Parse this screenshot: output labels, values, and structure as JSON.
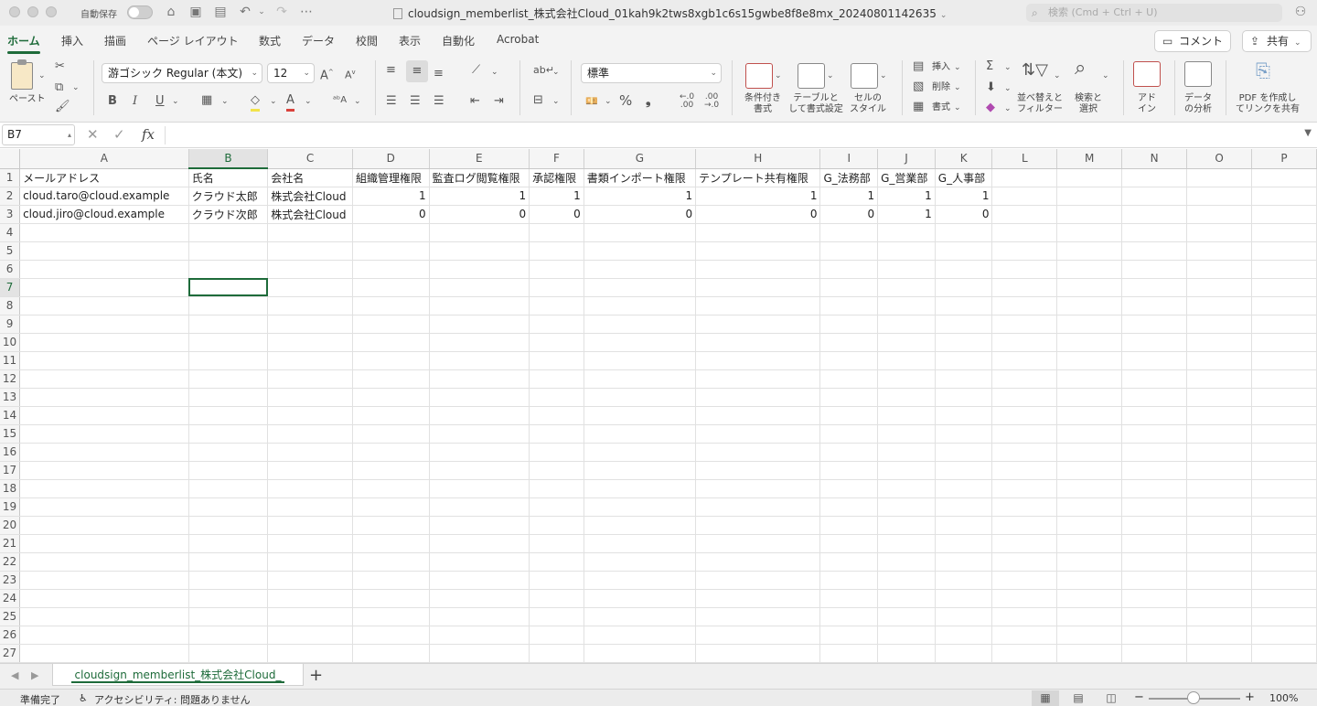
{
  "titlebar": {
    "autosave_label": "自動保存",
    "document_title": "cloudsign_memberlist_株式会社Cloud_01kah9k2tws8xgb1c6s15gwbe8f8e8mx_20240801142635",
    "search_placeholder": "検索 (Cmd + Ctrl + U)"
  },
  "ribbon_tabs": [
    "ホーム",
    "挿入",
    "描画",
    "ページ レイアウト",
    "数式",
    "データ",
    "校閲",
    "表示",
    "自動化",
    "Acrobat"
  ],
  "top_buttons": {
    "comment": "コメント",
    "share": "共有"
  },
  "ribbon": {
    "paste_label": "ペースト",
    "font_name": "游ゴシック Regular (本文)",
    "font_size": "12",
    "bold": "B",
    "italic": "I",
    "underline": "U",
    "number_format": "標準",
    "percent": "%",
    "comma": "❟",
    "conditional_format": [
      "条件付き",
      "書式"
    ],
    "format_as_table": [
      "テーブルと",
      "して書式設定"
    ],
    "cell_styles": [
      "セルの",
      "スタイル"
    ],
    "insert": "挿入",
    "delete": "削除",
    "format": "書式",
    "sort_filter": [
      "並べ替えと",
      "フィルター"
    ],
    "find_select": [
      "検索と",
      "選択"
    ],
    "addins": [
      "アド",
      "イン"
    ],
    "analyze_data": [
      "データ",
      "の分析"
    ],
    "create_pdf": [
      "PDF を作成し",
      "てリンクを共有"
    ]
  },
  "formula_bar": {
    "name_box": "B7",
    "fx": "fx",
    "formula": ""
  },
  "sheet": {
    "active_cell": "B7",
    "columns": [
      "A",
      "B",
      "C",
      "D",
      "E",
      "F",
      "G",
      "H",
      "I",
      "J",
      "K",
      "L",
      "M",
      "N",
      "O",
      "P"
    ],
    "rows": [
      [
        "メールアドレス",
        "氏名",
        "会社名",
        "組織管理権限",
        "監査ログ閲覧権限",
        "承認権限",
        "書類インポート権限",
        "テンプレート共有権限",
        "G_法務部",
        "G_営業部",
        "G_人事部",
        "",
        "",
        "",
        "",
        ""
      ],
      [
        "cloud.taro@cloud.example",
        "クラウド太郎",
        "株式会社Cloud",
        "1",
        "1",
        "1",
        "1",
        "1",
        "1",
        "1",
        "1",
        "",
        "",
        "",
        "",
        ""
      ],
      [
        "cloud.jiro@cloud.example",
        "クラウド次郎",
        "株式会社Cloud",
        "0",
        "0",
        "0",
        "0",
        "0",
        "0",
        "1",
        "0",
        "",
        "",
        "",
        "",
        ""
      ]
    ],
    "row_count": 27
  },
  "sheet_tabs": [
    "cloudsign_memberlist_株式会社Cloud_"
  ],
  "statusbar": {
    "ready": "準備完了",
    "accessibility": "アクセシビリティ: 問題ありません",
    "zoom": "100%"
  },
  "colors": {
    "accent": "#1e6b3a",
    "grid_line": "#e1e1e1"
  }
}
